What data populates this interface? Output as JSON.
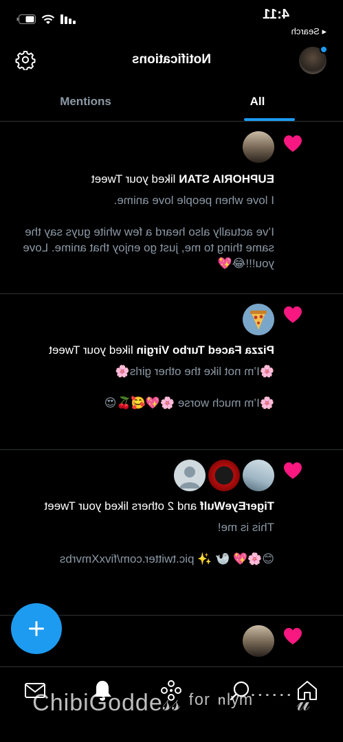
{
  "status_bar": {
    "time": "4:11",
    "back_label": "◂ Search"
  },
  "header": {
    "title": "Notifications"
  },
  "tabs": [
    {
      "label": "All",
      "active": true
    },
    {
      "label": "Mentions",
      "active": false
    }
  ],
  "notifications": [
    {
      "type": "like",
      "actor": "EUPHORIA STAN",
      "action": " liked your Tweet",
      "body": "I love when people love anime.\n\nI’ve actually also heard a few white guys say the same thing to me, just go enjoy that anime. Love you!!!😂💖"
    },
    {
      "type": "like",
      "actor": "Pizza Faced Turbo Virgin",
      "action": " liked your Tweet",
      "body": "🌸I’m not like the other girls🌸\n\n🌸I’m much worse 🌸💖🥰🍒😍"
    },
    {
      "type": "like",
      "actor": "TigerEyeWulf",
      "action": " and 2 others liked your Tweet",
      "body": "This is me!\n\n😊🌸💖 🦭 ✨ pic.twitter.com/fivxXmvrbs"
    },
    {
      "type": "like"
    }
  ],
  "fab": {
    "icon": "plus-icon",
    "color": "#1d9bf0"
  },
  "bottom_nav": [
    "home-icon",
    "search-icon",
    "spaces-icon",
    "notifications-icon",
    "messages-icon"
  ],
  "overlay_caption": "ChibiGodde𝓈𝓈 ᶠᵒʳ ⁿˡʸ ͫ ̇ ̇ ̇ ̇ ̇ ̇ 𝓊",
  "colors": {
    "accent": "#1d9bf0",
    "like": "#f91880",
    "background": "#000000",
    "muted_text": "#8b98a5"
  }
}
